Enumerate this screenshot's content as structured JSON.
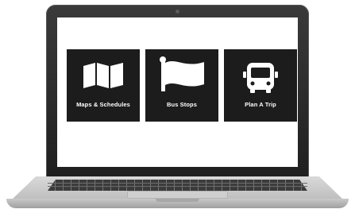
{
  "tiles": [
    {
      "label": "Maps & Schedules",
      "icon": "map-icon"
    },
    {
      "label": "Bus Stops",
      "icon": "flag-icon"
    },
    {
      "label": "Plan A Trip",
      "icon": "bus-icon"
    }
  ],
  "colors": {
    "tile_background": "#1c1c1c",
    "tile_foreground": "#ffffff",
    "screen_background": "#ffffff",
    "bezel": "#222222",
    "laptop_base": "#c8c8c8"
  }
}
